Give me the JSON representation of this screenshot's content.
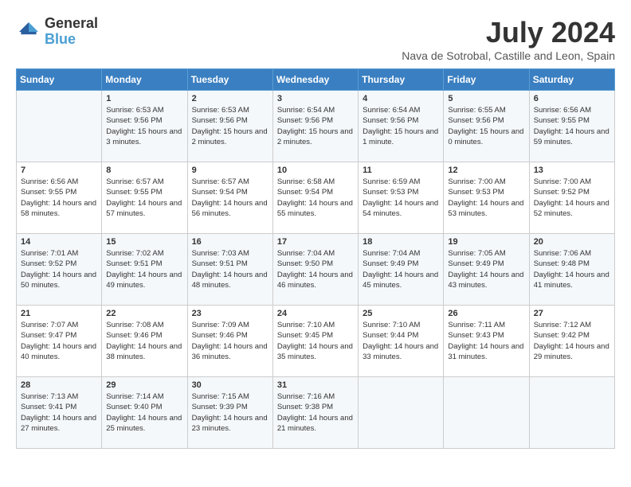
{
  "logo": {
    "line1": "General",
    "line2": "Blue"
  },
  "title": "July 2024",
  "subtitle": "Nava de Sotrobal, Castille and Leon, Spain",
  "weekdays": [
    "Sunday",
    "Monday",
    "Tuesday",
    "Wednesday",
    "Thursday",
    "Friday",
    "Saturday"
  ],
  "weeks": [
    [
      {
        "day": "",
        "sunrise": "",
        "sunset": "",
        "daylight": ""
      },
      {
        "day": "1",
        "sunrise": "Sunrise: 6:53 AM",
        "sunset": "Sunset: 9:56 PM",
        "daylight": "Daylight: 15 hours and 3 minutes."
      },
      {
        "day": "2",
        "sunrise": "Sunrise: 6:53 AM",
        "sunset": "Sunset: 9:56 PM",
        "daylight": "Daylight: 15 hours and 2 minutes."
      },
      {
        "day": "3",
        "sunrise": "Sunrise: 6:54 AM",
        "sunset": "Sunset: 9:56 PM",
        "daylight": "Daylight: 15 hours and 2 minutes."
      },
      {
        "day": "4",
        "sunrise": "Sunrise: 6:54 AM",
        "sunset": "Sunset: 9:56 PM",
        "daylight": "Daylight: 15 hours and 1 minute."
      },
      {
        "day": "5",
        "sunrise": "Sunrise: 6:55 AM",
        "sunset": "Sunset: 9:56 PM",
        "daylight": "Daylight: 15 hours and 0 minutes."
      },
      {
        "day": "6",
        "sunrise": "Sunrise: 6:56 AM",
        "sunset": "Sunset: 9:55 PM",
        "daylight": "Daylight: 14 hours and 59 minutes."
      }
    ],
    [
      {
        "day": "7",
        "sunrise": "Sunrise: 6:56 AM",
        "sunset": "Sunset: 9:55 PM",
        "daylight": "Daylight: 14 hours and 58 minutes."
      },
      {
        "day": "8",
        "sunrise": "Sunrise: 6:57 AM",
        "sunset": "Sunset: 9:55 PM",
        "daylight": "Daylight: 14 hours and 57 minutes."
      },
      {
        "day": "9",
        "sunrise": "Sunrise: 6:57 AM",
        "sunset": "Sunset: 9:54 PM",
        "daylight": "Daylight: 14 hours and 56 minutes."
      },
      {
        "day": "10",
        "sunrise": "Sunrise: 6:58 AM",
        "sunset": "Sunset: 9:54 PM",
        "daylight": "Daylight: 14 hours and 55 minutes."
      },
      {
        "day": "11",
        "sunrise": "Sunrise: 6:59 AM",
        "sunset": "Sunset: 9:53 PM",
        "daylight": "Daylight: 14 hours and 54 minutes."
      },
      {
        "day": "12",
        "sunrise": "Sunrise: 7:00 AM",
        "sunset": "Sunset: 9:53 PM",
        "daylight": "Daylight: 14 hours and 53 minutes."
      },
      {
        "day": "13",
        "sunrise": "Sunrise: 7:00 AM",
        "sunset": "Sunset: 9:52 PM",
        "daylight": "Daylight: 14 hours and 52 minutes."
      }
    ],
    [
      {
        "day": "14",
        "sunrise": "Sunrise: 7:01 AM",
        "sunset": "Sunset: 9:52 PM",
        "daylight": "Daylight: 14 hours and 50 minutes."
      },
      {
        "day": "15",
        "sunrise": "Sunrise: 7:02 AM",
        "sunset": "Sunset: 9:51 PM",
        "daylight": "Daylight: 14 hours and 49 minutes."
      },
      {
        "day": "16",
        "sunrise": "Sunrise: 7:03 AM",
        "sunset": "Sunset: 9:51 PM",
        "daylight": "Daylight: 14 hours and 48 minutes."
      },
      {
        "day": "17",
        "sunrise": "Sunrise: 7:04 AM",
        "sunset": "Sunset: 9:50 PM",
        "daylight": "Daylight: 14 hours and 46 minutes."
      },
      {
        "day": "18",
        "sunrise": "Sunrise: 7:04 AM",
        "sunset": "Sunset: 9:49 PM",
        "daylight": "Daylight: 14 hours and 45 minutes."
      },
      {
        "day": "19",
        "sunrise": "Sunrise: 7:05 AM",
        "sunset": "Sunset: 9:49 PM",
        "daylight": "Daylight: 14 hours and 43 minutes."
      },
      {
        "day": "20",
        "sunrise": "Sunrise: 7:06 AM",
        "sunset": "Sunset: 9:48 PM",
        "daylight": "Daylight: 14 hours and 41 minutes."
      }
    ],
    [
      {
        "day": "21",
        "sunrise": "Sunrise: 7:07 AM",
        "sunset": "Sunset: 9:47 PM",
        "daylight": "Daylight: 14 hours and 40 minutes."
      },
      {
        "day": "22",
        "sunrise": "Sunrise: 7:08 AM",
        "sunset": "Sunset: 9:46 PM",
        "daylight": "Daylight: 14 hours and 38 minutes."
      },
      {
        "day": "23",
        "sunrise": "Sunrise: 7:09 AM",
        "sunset": "Sunset: 9:46 PM",
        "daylight": "Daylight: 14 hours and 36 minutes."
      },
      {
        "day": "24",
        "sunrise": "Sunrise: 7:10 AM",
        "sunset": "Sunset: 9:45 PM",
        "daylight": "Daylight: 14 hours and 35 minutes."
      },
      {
        "day": "25",
        "sunrise": "Sunrise: 7:10 AM",
        "sunset": "Sunset: 9:44 PM",
        "daylight": "Daylight: 14 hours and 33 minutes."
      },
      {
        "day": "26",
        "sunrise": "Sunrise: 7:11 AM",
        "sunset": "Sunset: 9:43 PM",
        "daylight": "Daylight: 14 hours and 31 minutes."
      },
      {
        "day": "27",
        "sunrise": "Sunrise: 7:12 AM",
        "sunset": "Sunset: 9:42 PM",
        "daylight": "Daylight: 14 hours and 29 minutes."
      }
    ],
    [
      {
        "day": "28",
        "sunrise": "Sunrise: 7:13 AM",
        "sunset": "Sunset: 9:41 PM",
        "daylight": "Daylight: 14 hours and 27 minutes."
      },
      {
        "day": "29",
        "sunrise": "Sunrise: 7:14 AM",
        "sunset": "Sunset: 9:40 PM",
        "daylight": "Daylight: 14 hours and 25 minutes."
      },
      {
        "day": "30",
        "sunrise": "Sunrise: 7:15 AM",
        "sunset": "Sunset: 9:39 PM",
        "daylight": "Daylight: 14 hours and 23 minutes."
      },
      {
        "day": "31",
        "sunrise": "Sunrise: 7:16 AM",
        "sunset": "Sunset: 9:38 PM",
        "daylight": "Daylight: 14 hours and 21 minutes."
      },
      {
        "day": "",
        "sunrise": "",
        "sunset": "",
        "daylight": ""
      },
      {
        "day": "",
        "sunrise": "",
        "sunset": "",
        "daylight": ""
      },
      {
        "day": "",
        "sunrise": "",
        "sunset": "",
        "daylight": ""
      }
    ]
  ]
}
